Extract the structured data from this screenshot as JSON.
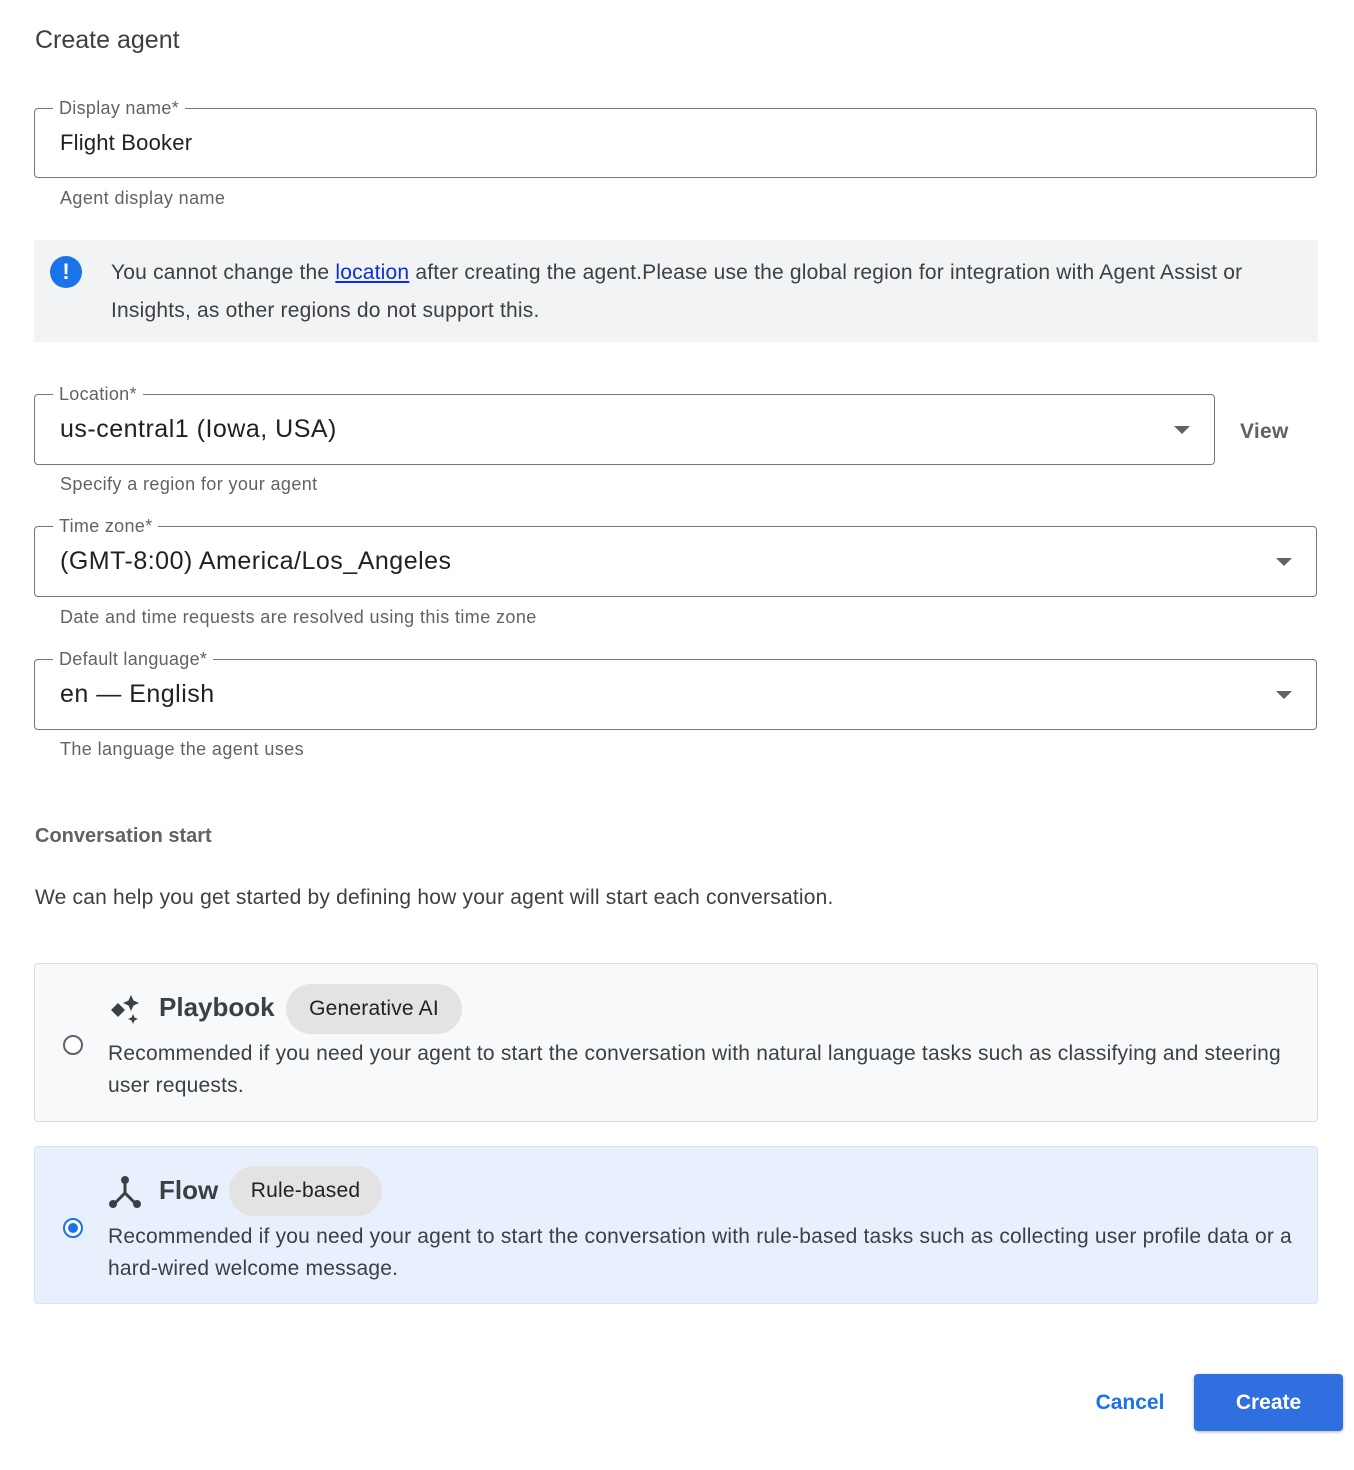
{
  "dialog": {
    "title": "Create agent"
  },
  "display_name": {
    "label": "Display name*",
    "value": "Flight Booker",
    "hint": "Agent display name"
  },
  "notice": {
    "text_before": "You cannot change the ",
    "link": "location",
    "text_after": " after creating the agent.Please use the global region for integration with Agent Assist or Insights, as other regions do not support this.",
    "icon": "info-icon"
  },
  "location": {
    "label": "Location*",
    "value": "us-central1 (Iowa, USA)",
    "hint": "Specify a region for your agent",
    "view_label": "View"
  },
  "time_zone": {
    "label": "Time zone*",
    "value": "(GMT-8:00) America/Los_Angeles",
    "hint": "Date and time requests are resolved using this time zone"
  },
  "default_language": {
    "label": "Default language*",
    "value": "en — English",
    "hint": "The language the agent uses"
  },
  "conversation_start": {
    "heading": "Conversation start",
    "description": "We can help you get started by defining how your agent will start each conversation.",
    "options": [
      {
        "title": "Playbook",
        "chip": "Generative AI",
        "description": "Recommended if you need your agent to start the conversation with natural language tasks such as classifying and steering user requests.",
        "selected": false,
        "icon": "sparkle-icon"
      },
      {
        "title": "Flow",
        "chip": "Rule-based",
        "description": "Recommended if you need your agent to start the conversation with rule-based tasks such as collecting user profile data or a hard-wired welcome message.",
        "selected": true,
        "icon": "flow-icon"
      }
    ]
  },
  "actions": {
    "cancel": "Cancel",
    "create": "Create"
  },
  "colors": {
    "accent": "#1a73e8",
    "primary_button": "#2f6fe0",
    "selected_card_bg": "#e8f0fe"
  }
}
